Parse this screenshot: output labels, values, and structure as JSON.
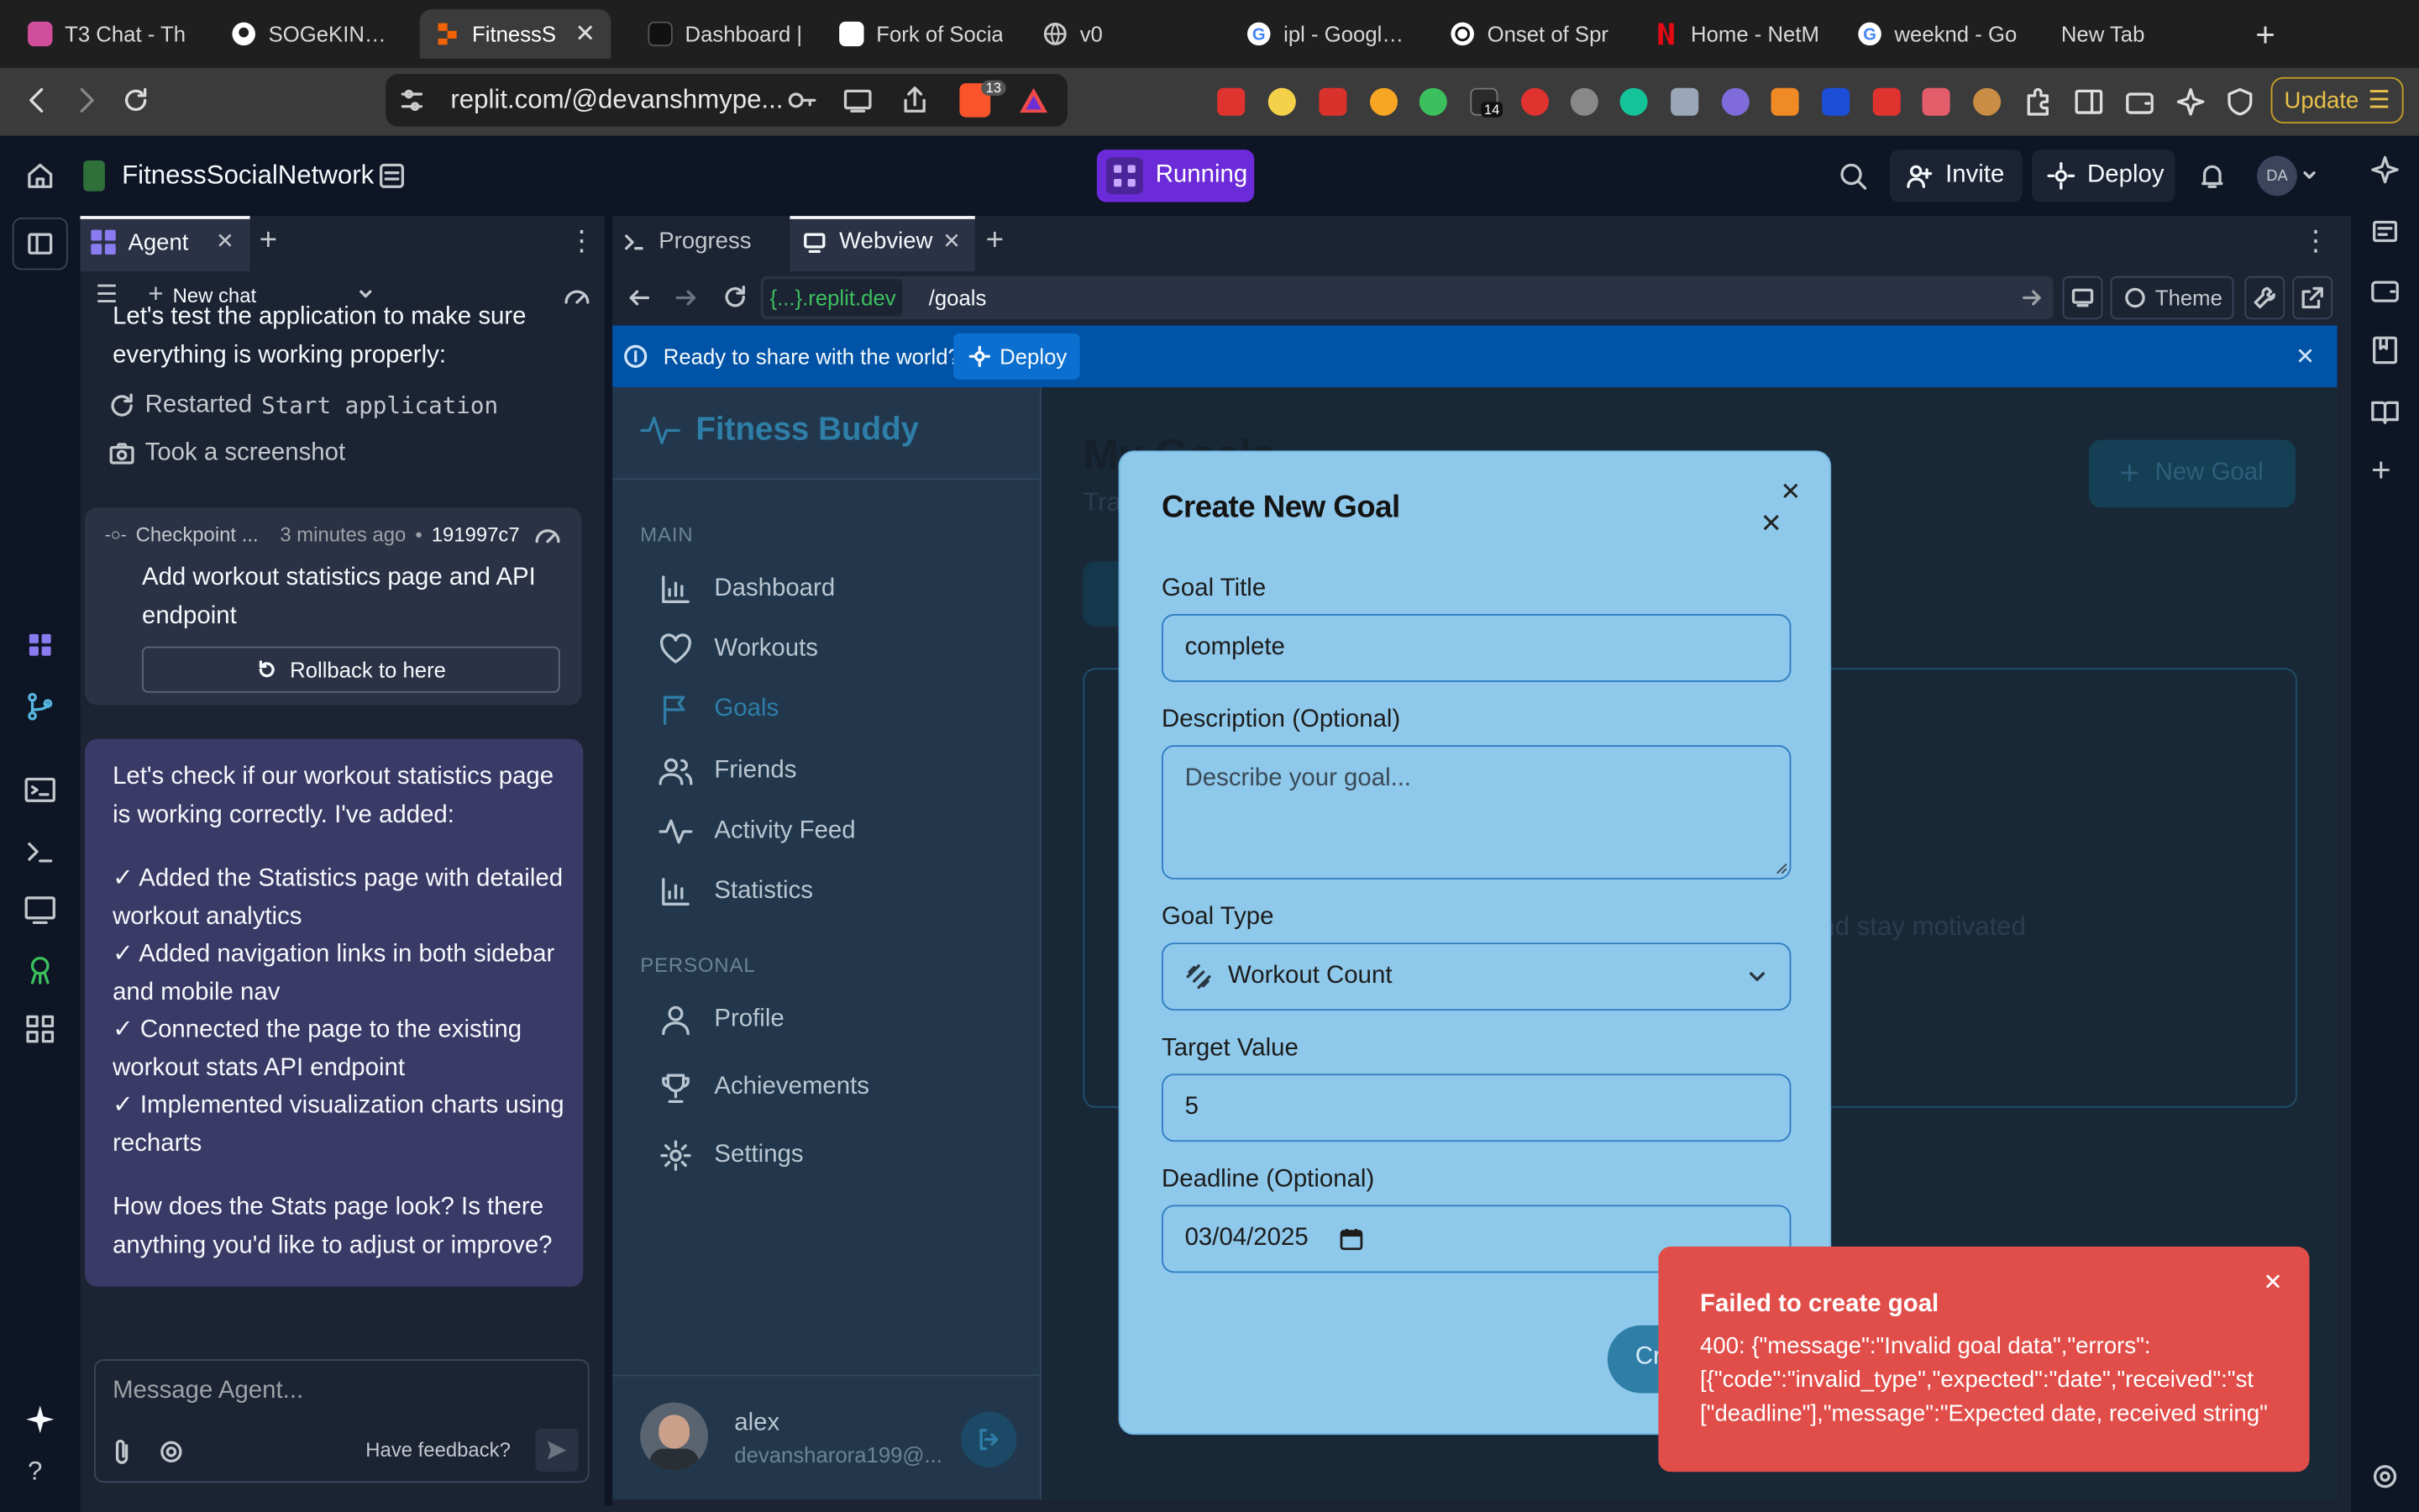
{
  "browser": {
    "tabs": [
      {
        "label": "T3 Chat - Th",
        "color": "#d14f9a"
      },
      {
        "label": "SOGeKING-N",
        "color": "#ffffff"
      },
      {
        "label": "FitnessS",
        "color": "#f26207",
        "active": true
      },
      {
        "label": "Dashboard |",
        "color": "#1f1f1f"
      },
      {
        "label": "Fork of Socia",
        "color": "#ffffff"
      },
      {
        "label": "v0",
        "color": "#cccccc"
      },
      {
        "label": "ipl - Google S",
        "color": "#ffffff"
      },
      {
        "label": "Onset of Spr",
        "color": "#ffffff"
      },
      {
        "label": "Home - NetM",
        "color": "#e50914"
      },
      {
        "label": "weeknd - Go",
        "color": "#ffffff"
      },
      {
        "label": "New Tab",
        "color": "#1f1f1f"
      }
    ],
    "url": "replit.com/@devanshmype...",
    "shield_count": "13",
    "ext_badge": "14",
    "update_label": "Update"
  },
  "header": {
    "project_name": "FitnessSocialNetwork",
    "run_label": "Running",
    "invite_label": "Invite",
    "deploy_label": "Deploy",
    "avatar": "DA"
  },
  "agent": {
    "tab_label": "Agent",
    "new_chat_label": "New chat",
    "intro_lines": [
      "Let's test the application to make sure",
      "everything is working properly:"
    ],
    "action_restart_prefix": "Restarted ",
    "action_restart_code": "Start application",
    "action_screenshot": "Took a screenshot",
    "checkpoint": {
      "label": "Checkpoint ...",
      "time": "3 minutes ago",
      "sep": "•",
      "hash": "191997c7",
      "title": [
        "Add workout statistics page and API",
        "endpoint"
      ],
      "rollback_label": "Rollback to here"
    },
    "bubble": {
      "lines": [
        "Let's check if our workout statistics page",
        "is working correctly. I've added:",
        "",
        "✓ Added the Statistics page with detailed",
        "workout analytics",
        "✓ Added navigation links in both sidebar",
        "and mobile nav",
        "✓ Connected the page to the existing",
        "workout stats API endpoint",
        "✓ Implemented visualization charts using",
        "recharts",
        "",
        "How does the Stats page look? Is there",
        "anything you'd like to adjust or improve?"
      ]
    },
    "composer_placeholder": "Message Agent...",
    "feedback_label": "Have feedback?"
  },
  "webview": {
    "tabs": [
      {
        "label": "Progress"
      },
      {
        "label": "Webview"
      }
    ],
    "domain": "{...}.replit.dev",
    "path": "/goals",
    "theme_label": "Theme",
    "banner_text": "Ready to share with the world?",
    "banner_deploy": "Deploy"
  },
  "app": {
    "brand": "Fitness Buddy",
    "section_main": "MAIN",
    "section_personal": "PERSONAL",
    "nav_main": [
      "Dashboard",
      "Workouts",
      "Goals",
      "Friends",
      "Activity Feed",
      "Statistics"
    ],
    "nav_personal": [
      "Profile",
      "Achievements",
      "Settings"
    ],
    "page_title": "My Goals",
    "page_subtitle": "Tra",
    "new_goal_label": "New Goal",
    "empty_text": "nd stay motivated",
    "user_name": "alex",
    "user_email": "devansharora199@..."
  },
  "modal": {
    "title": "Create New Goal",
    "goal_title_label": "Goal Title",
    "goal_title_value": "complete",
    "description_label": "Description (Optional)",
    "description_placeholder": "Describe your goal...",
    "goal_type_label": "Goal Type",
    "goal_type_value": "Workout Count",
    "target_label": "Target Value",
    "target_value": "5",
    "deadline_label": "Deadline (Optional)",
    "deadline_value": "03/04/2025",
    "submit_label": "Cr"
  },
  "toast": {
    "title": "Failed to create goal",
    "lines": [
      "400: {\"message\":\"Invalid goal data\",\"errors\":",
      "[{\"code\":\"invalid_type\",\"expected\":\"date\",\"received\":\"st",
      "[\"deadline\"],\"message\":\"Expected date, received string\""
    ]
  },
  "colors": {
    "replit_bg": "#0e1525",
    "run_button": "#6c2bd9",
    "modal_bg": "#8ec8ea",
    "toast_bg": "#e14e4a",
    "banner_bg": "#0053a6",
    "brand_teal": "#2e7ea8"
  }
}
